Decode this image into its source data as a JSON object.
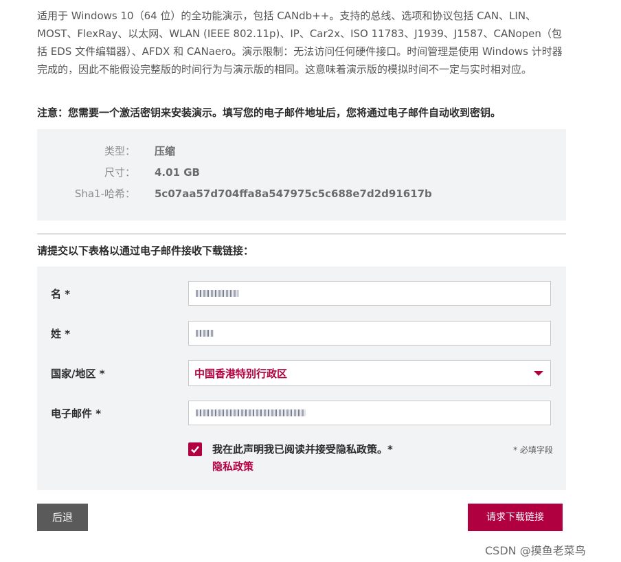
{
  "intro": {
    "text": "适用于 Windows 10（64 位）的全功能演示，包括 CANdb++。支持的总线、选项和协议包括 CAN、LIN、MOST、FlexRay、以太网、WLAN (IEEE 802.11p)、IP、Car2x、ISO 11783、J1939、J1587、CANopen（包括 EDS 文件编辑器）、AFDX 和 CANaero。演示限制：无法访问任何硬件接口。时间管理是使用 Windows 计时器完成的，因此不能假设完整版的时间行为与演示版的相同。这意味着演示版的模拟时间不一定与实时相对应。"
  },
  "note": "注意：您需要一个激活密钥来安装演示。填写您的电子邮件地址后，您将通过电子邮件自动收到密钥。",
  "file_info": {
    "type_label": "类型：",
    "type_value": "压缩",
    "size_label": "尺寸：",
    "size_value": "4.01 GB",
    "sha1_label": "Sha1-哈希：",
    "sha1_value": "5c07aa57d704ffa8a547975c5c688e7d2d91617b"
  },
  "form": {
    "title": "请提交以下表格以通过电子邮件接收下载链接：",
    "first_name_label": "名 *",
    "last_name_label": "姓 *",
    "country_label": "国家/地区 *",
    "country_value": "中国香港特别行政区",
    "email_label": "电子邮件 *",
    "consent_text": "我在此声明我已阅读并接受隐私政策。*",
    "privacy_link": "隐私政策",
    "required_note": "* 必填字段"
  },
  "buttons": {
    "back": "后退",
    "request": "请求下载链接"
  },
  "watermark": "CSDN @摸鱼老菜鸟",
  "colors": {
    "accent": "#b1003f",
    "panel": "#f2f3f4",
    "back_button": "#5a5a5a"
  }
}
